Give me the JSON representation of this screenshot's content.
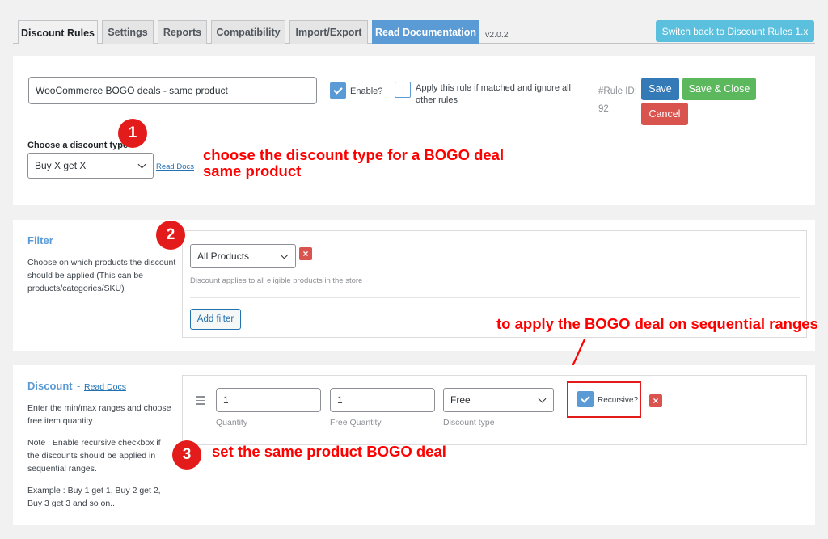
{
  "tabs": [
    {
      "label": "Discount Rules"
    },
    {
      "label": "Settings"
    },
    {
      "label": "Reports"
    },
    {
      "label": "Compatibility"
    },
    {
      "label": "Import/Export"
    },
    {
      "label": "Read Documentation"
    }
  ],
  "version": "v2.0.2",
  "switch_back_label": "Switch back to Discount Rules 1.x",
  "rule": {
    "title_value": "WooCommerce BOGO deals - same product",
    "enable_label": "Enable?",
    "enable_checked": true,
    "apply_ignore_label": "Apply this rule if matched and ignore all other rules",
    "apply_ignore_checked": false,
    "rule_id_label": "#Rule ID:",
    "rule_id_value": "92",
    "save_label": "Save",
    "save_close_label": "Save & Close",
    "cancel_label": "Cancel",
    "discount_type_label": "Choose a discount type",
    "discount_type_value": "Buy X get X",
    "read_docs_label": "Read Docs"
  },
  "filter": {
    "title": "Filter",
    "description": "Choose on which products the discount should be applied (This can be products/categories/SKU)",
    "select_value": "All Products",
    "help_text": "Discount applies to all eligible products in the store",
    "add_filter_label": "Add filter"
  },
  "discount": {
    "title": "Discount",
    "separator": "-",
    "read_docs_label": "Read Docs",
    "desc1": "Enter the min/max ranges and choose free item quantity.",
    "desc2": "Note : Enable recursive checkbox if the discounts should be applied in sequential ranges.",
    "desc3": "Example : Buy 1 get 1, Buy 2 get 2, Buy 3 get 3 and so on..",
    "quantity_value": "1",
    "quantity_label": "Quantity",
    "free_quantity_value": "1",
    "free_quantity_label": "Free Quantity",
    "discount_type_value": "Free",
    "discount_type_label": "Discount type",
    "recursive_label": "Recursive?",
    "recursive_checked": true
  },
  "annotations": {
    "n1": "1",
    "n2": "2",
    "n3": "3",
    "a1": "choose the discount type for a BOGO deal same product",
    "a2": "to apply the BOGO deal on sequential ranges",
    "a3": "set the same product BOGO deal"
  },
  "colors": {
    "accent": "#5b9bd5",
    "annotation": "#ff0000",
    "save": "#337ab7",
    "save_close": "#5cb85c",
    "cancel": "#d9534f"
  }
}
